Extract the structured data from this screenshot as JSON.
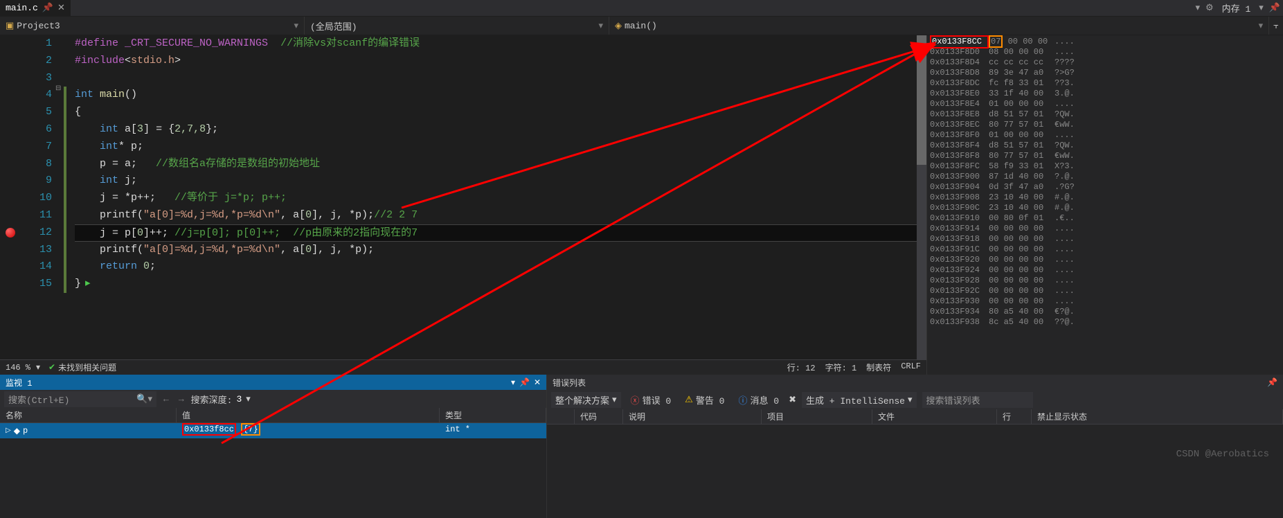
{
  "tab": {
    "name": "main.c",
    "pin_icon": "📌",
    "close_icon": "✕"
  },
  "top_right": {
    "memory_title": "内存 1"
  },
  "nav": {
    "project": "Project3",
    "scope": "(全局范围)",
    "function": "main()"
  },
  "linenums": [
    "1",
    "2",
    "3",
    "4",
    "5",
    "6",
    "7",
    "8",
    "9",
    "10",
    "11",
    "12",
    "13",
    "14",
    "15"
  ],
  "code": {
    "line1_define": "#define ",
    "line1_crt": "_CRT_SECURE_NO_WARNINGS",
    "line1_com": "  //消除vs对scanf的编译错误",
    "line2_inc": "#include",
    "line2_lt": "<",
    "line2_hdr": "stdio.h",
    "line2_gt": ">",
    "line4_int": "int ",
    "line4_main": "main",
    "line4_paren": "()",
    "line5_brace": "{",
    "line6_pre": "    ",
    "line6_int": "int ",
    "line6_a": "a[",
    "line6_3": "3",
    "line6_b": "] = {",
    "line6_vals": "2,7,8",
    "line6_end": "};",
    "line7_pre": "    ",
    "line7_int": "int",
    "line7_p": "* p;",
    "line8_pre": "    p = a;   ",
    "line8_com": "//数组名a存储的是数组的初始地址",
    "line9_pre": "    ",
    "line9_int": "int ",
    "line9_j": "j;",
    "line10_pre": "    j = *p++;   ",
    "line10_com": "//等价于 j=*p; p++;",
    "line11_pre": "    printf(",
    "line11_str": "\"a[0]=%d,j=%d,*p=%d\\n\"",
    "line11_args": ", a[",
    "line11_0": "0",
    "line11_rest": "], j, *p);",
    "line11_com": "//2 2 7",
    "line12_pre": "    j = p[",
    "line12_0a": "0",
    "line12_mid": "]++; ",
    "line12_com1": "//j=p[0]; p[0]++;  ",
    "line12_com2": "//p由原来的2指向现在的7",
    "line13_pre": "    printf(",
    "line13_str": "\"a[0]=%d,j=%d,*p=%d\\n\"",
    "line13_args": ", a[",
    "line13_0": "0",
    "line13_rest": "], j, *p);",
    "line14_pre": "    ",
    "line14_ret": "return ",
    "line14_0": "0",
    "line14_end": ";",
    "line15_brace": "}"
  },
  "status": {
    "zoom": "146 %",
    "problem": "未找到相关问题",
    "line": "行: 12",
    "col": "字符: 1",
    "tabs": "制表符",
    "crlf": "CRLF"
  },
  "memory": [
    {
      "addr": "0x0133F8CC",
      "bytes": "07 00 00 00",
      "ascii": "....",
      "hl_addr": true,
      "hl_byte": true
    },
    {
      "addr": "0x0133F8D0",
      "bytes": "08 00 00 00",
      "ascii": "...."
    },
    {
      "addr": "0x0133F8D4",
      "bytes": "cc cc cc cc",
      "ascii": "????"
    },
    {
      "addr": "0x0133F8D8",
      "bytes": "89 3e 47 a0",
      "ascii": "?>G?"
    },
    {
      "addr": "0x0133F8DC",
      "bytes": "fc f8 33 01",
      "ascii": "??3."
    },
    {
      "addr": "0x0133F8E0",
      "bytes": "33 1f 40 00",
      "ascii": "3.@."
    },
    {
      "addr": "0x0133F8E4",
      "bytes": "01 00 00 00",
      "ascii": "...."
    },
    {
      "addr": "0x0133F8E8",
      "bytes": "d8 51 57 01",
      "ascii": "?QW."
    },
    {
      "addr": "0x0133F8EC",
      "bytes": "80 77 57 01",
      "ascii": "€wW."
    },
    {
      "addr": "0x0133F8F0",
      "bytes": "01 00 00 00",
      "ascii": "...."
    },
    {
      "addr": "0x0133F8F4",
      "bytes": "d8 51 57 01",
      "ascii": "?QW."
    },
    {
      "addr": "0x0133F8F8",
      "bytes": "80 77 57 01",
      "ascii": "€wW."
    },
    {
      "addr": "0x0133F8FC",
      "bytes": "58 f9 33 01",
      "ascii": "X?3."
    },
    {
      "addr": "0x0133F900",
      "bytes": "87 1d 40 00",
      "ascii": "?.@."
    },
    {
      "addr": "0x0133F904",
      "bytes": "0d 3f 47 a0",
      "ascii": ".?G?"
    },
    {
      "addr": "0x0133F908",
      "bytes": "23 10 40 00",
      "ascii": "#.@."
    },
    {
      "addr": "0x0133F90C",
      "bytes": "23 10 40 00",
      "ascii": "#.@."
    },
    {
      "addr": "0x0133F910",
      "bytes": "00 80 0f 01",
      "ascii": ".€.."
    },
    {
      "addr": "0x0133F914",
      "bytes": "00 00 00 00",
      "ascii": "...."
    },
    {
      "addr": "0x0133F918",
      "bytes": "00 00 00 00",
      "ascii": "...."
    },
    {
      "addr": "0x0133F91C",
      "bytes": "00 00 00 00",
      "ascii": "...."
    },
    {
      "addr": "0x0133F920",
      "bytes": "00 00 00 00",
      "ascii": "...."
    },
    {
      "addr": "0x0133F924",
      "bytes": "00 00 00 00",
      "ascii": "...."
    },
    {
      "addr": "0x0133F928",
      "bytes": "00 00 00 00",
      "ascii": "...."
    },
    {
      "addr": "0x0133F92C",
      "bytes": "00 00 00 00",
      "ascii": "...."
    },
    {
      "addr": "0x0133F930",
      "bytes": "00 00 00 00",
      "ascii": "...."
    },
    {
      "addr": "0x0133F934",
      "bytes": "80 a5 40 00",
      "ascii": "€?@."
    },
    {
      "addr": "0x0133F938",
      "bytes": "8c a5 40 00",
      "ascii": "??@."
    }
  ],
  "watch": {
    "title": "监视 1",
    "search_placeholder": "搜索(Ctrl+E)",
    "depth_label": "搜索深度:",
    "depth_value": "3",
    "cols": {
      "name": "名称",
      "value": "值",
      "type": "类型"
    },
    "row": {
      "name": "p",
      "value_addr": "0x0133f8cc",
      "value_deref": "{7}",
      "type": "int *"
    }
  },
  "errors": {
    "title": "错误列表",
    "solution": "整个解决方案",
    "error_btn": "错误 0",
    "warn_btn": "警告 0",
    "msg_btn": "消息 0",
    "build": "生成 + IntelliSense",
    "search_placeholder": "搜索错误列表",
    "cols": {
      "code": "代码",
      "desc": "说明",
      "project": "项目",
      "file": "文件",
      "line": "行",
      "suppress": "禁止显示状态"
    }
  },
  "watermark": "CSDN @Aerobatics"
}
